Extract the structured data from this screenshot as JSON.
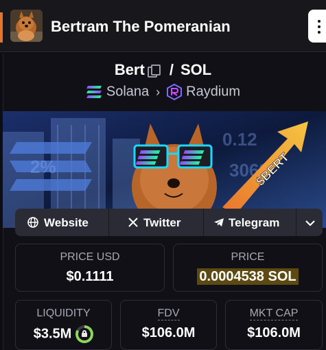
{
  "header": {
    "title": "Bertram The Pomeranian",
    "avatar_icon": "pomeranian-avatar",
    "menu_icon": "kebab-menu-icon",
    "accent_color": "#e8742c"
  },
  "pair": {
    "base": "Bert",
    "separator": "/",
    "quote": "SOL",
    "chain": "Solana",
    "dex": "Raydium"
  },
  "banner": {
    "tag": "$BERT"
  },
  "links": {
    "website": "Website",
    "twitter": "Twitter",
    "telegram": "Telegram"
  },
  "stats": {
    "price_usd_label": "PRICE USD",
    "price_usd_value": "$0.1111",
    "price_label": "PRICE",
    "price_value": "0.0004538 SOL",
    "liquidity_label": "LIQUIDITY",
    "liquidity_value": "$3.5M",
    "fdv_label": "FDV",
    "fdv_value": "$106.0M",
    "mktcap_label": "MKT CAP",
    "mktcap_value": "$106.0M",
    "liquidity_lock_fraction": 0.83
  },
  "colors": {
    "background": "#0e0e12",
    "card_border": "#2e2e38",
    "highlight": "#5c4a12",
    "lock_green": "#8bd75a"
  }
}
